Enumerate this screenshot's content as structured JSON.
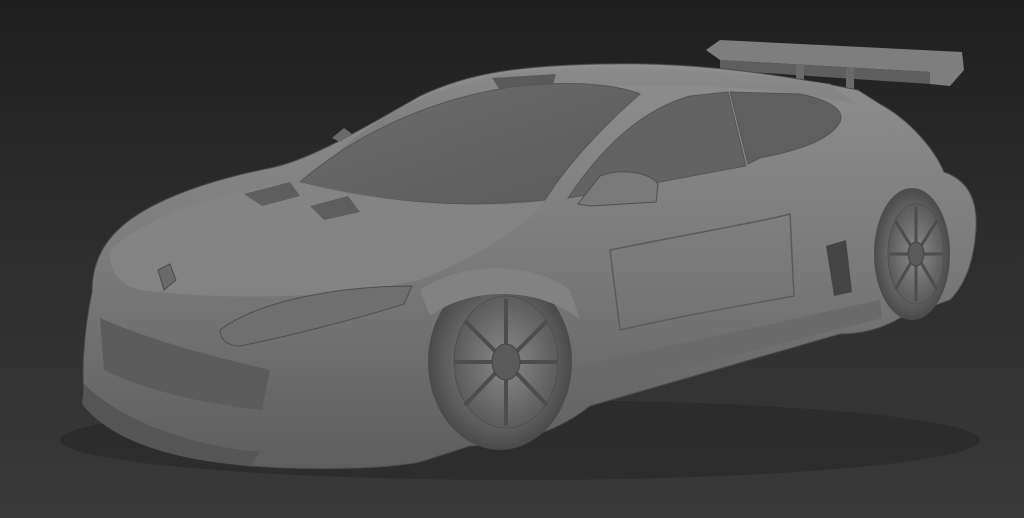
{
  "scene": {
    "subject": "car-model-render",
    "background_top": "#1f1f1f",
    "background_bottom": "#3a3a3a",
    "body_color": "#7c7c7c"
  }
}
